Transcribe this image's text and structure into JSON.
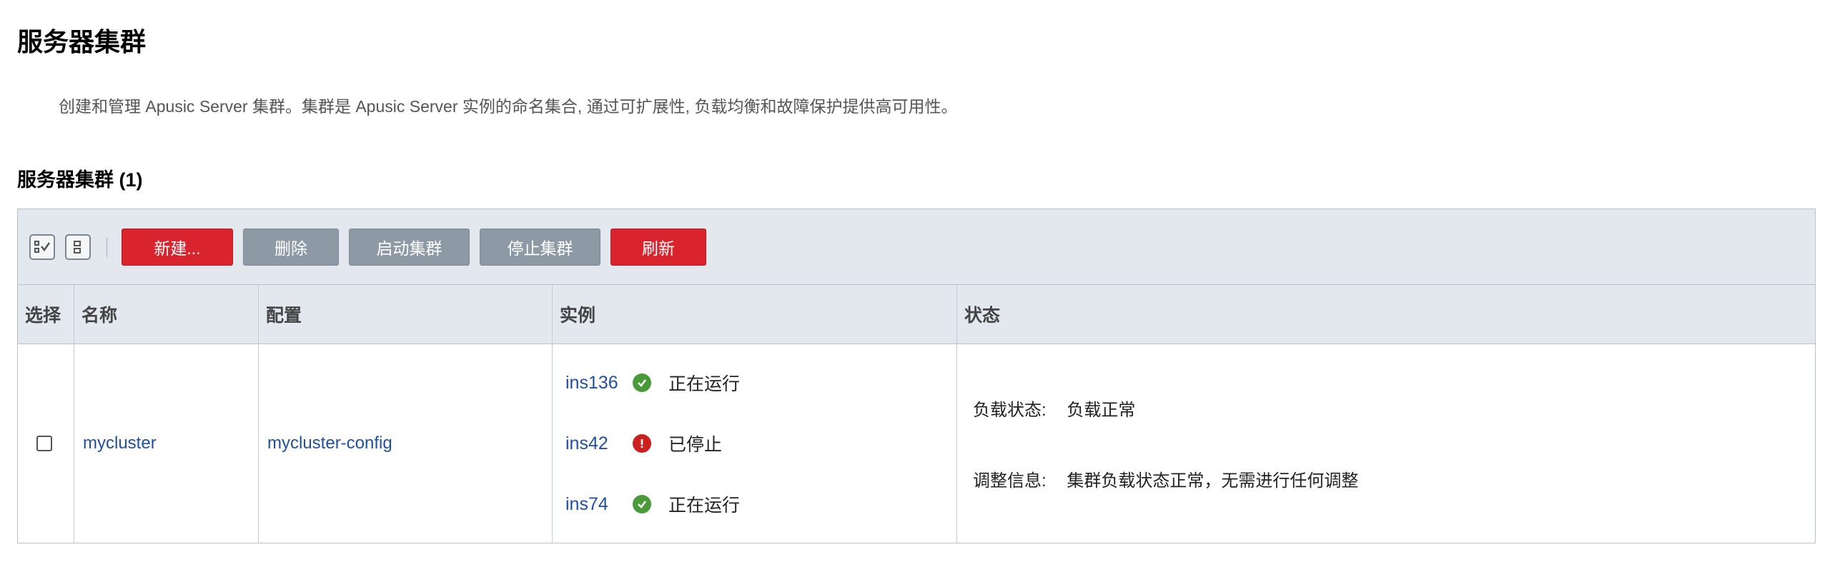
{
  "page": {
    "title": "服务器集群",
    "description": "创建和管理 Apusic Server 集群。集群是 Apusic Server 实例的命名集合, 通过可扩展性, 负载均衡和故障保护提供高可用性。"
  },
  "section": {
    "title": "服务器集群 (1)"
  },
  "toolbar": {
    "select_all_icon": "select-all-icon",
    "deselect_all_icon": "deselect-all-icon",
    "buttons": {
      "new_label": "新建...",
      "delete_label": "删除",
      "start_label": "启动集群",
      "stop_label": "停止集群",
      "refresh_label": "刷新"
    }
  },
  "table": {
    "headers": {
      "select": "选择",
      "name": "名称",
      "config": "配置",
      "instances": "实例",
      "status": "状态"
    },
    "rows": [
      {
        "selected": false,
        "name": "mycluster",
        "config": "mycluster-config",
        "instances": [
          {
            "name": "ins136",
            "status_icon": "ok-icon",
            "status": "正在运行"
          },
          {
            "name": "ins42",
            "status_icon": "error-icon",
            "status": "已停止"
          },
          {
            "name": "ins74",
            "status_icon": "ok-icon",
            "status": "正在运行"
          }
        ],
        "load_status_label": "负载状态:",
        "load_status_value": "负载正常",
        "adjust_info_label": "调整信息:",
        "adjust_info_value": "集群负载状态正常，无需进行任何调整"
      }
    ]
  },
  "colors": {
    "primary_button": "#d9242e",
    "secondary_button": "#8d99a5",
    "link": "#2050a0",
    "ok": "#4a9a3a",
    "error": "#cc1f1f"
  }
}
